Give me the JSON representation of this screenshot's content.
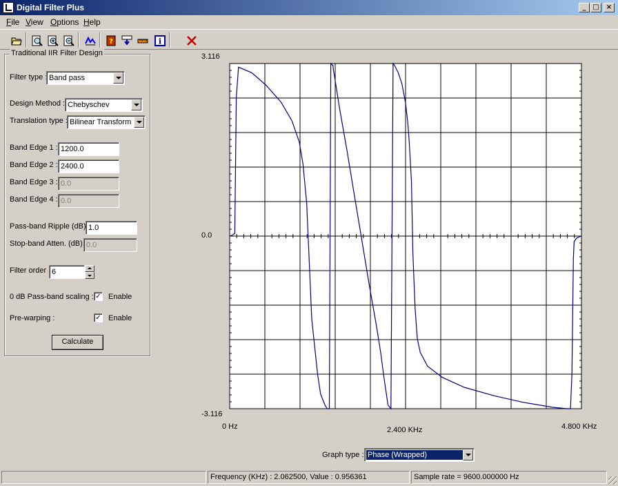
{
  "window": {
    "title": "Digital Filter Plus",
    "controls": {
      "minimize": "_",
      "maximize": "□",
      "close": "×"
    }
  },
  "menu": [
    {
      "label": "File",
      "mnemonic": "F",
      "rest": "ile"
    },
    {
      "label": "View",
      "mnemonic": "V",
      "rest": "iew"
    },
    {
      "label": "Options",
      "mnemonic": "O",
      "rest": "ptions"
    },
    {
      "label": "Help",
      "mnemonic": "H",
      "rest": "elp"
    }
  ],
  "toolbar": {
    "icons": [
      "open-folder-icon",
      "zoom-icon",
      "zoom-in-icon",
      "zoom-out-icon",
      "filter-response-icon",
      "help-icon",
      "download-icon",
      "ruler-icon",
      "info-icon",
      "close-design-icon"
    ]
  },
  "design": {
    "group_title": "Traditional IIR Filter Design",
    "filter_type": {
      "label": "Filter type :",
      "value": "Band pass"
    },
    "design_method": {
      "label": "Design Method :",
      "value": "Chebyschev"
    },
    "translation_type": {
      "label": "Translation type :",
      "value": "Bilinear Transform"
    },
    "band_edge_1": {
      "label": "Band Edge 1 :",
      "value": "1200.0"
    },
    "band_edge_2": {
      "label": "Band Edge 2 :",
      "value": "2400.0"
    },
    "band_edge_3": {
      "label": "Band Edge 3 :",
      "value": "0.0"
    },
    "band_edge_4": {
      "label": "Band Edge 4 :",
      "value": "0.0"
    },
    "passband_ripple": {
      "label": "Pass-band Ripple (dB):",
      "value": "1.0"
    },
    "stopband_atten": {
      "label": "Stop-band Atten. (dB):",
      "value": "0.0"
    },
    "filter_order": {
      "label": "Filter order :",
      "value": "6"
    },
    "passband_scaling": {
      "label": "0 dB Pass-band scaling :",
      "check_label": "Enable",
      "checked": true
    },
    "prewarping": {
      "label": "Pre-warping :",
      "check_label": "Enable",
      "checked": true
    },
    "calculate_label": "Calculate"
  },
  "graph": {
    "graph_type_label": "Graph type :",
    "graph_type_value": "Phase (Wrapped)",
    "line_color": "#00007f"
  },
  "chart_data": {
    "type": "line",
    "title": "",
    "xlabel": "",
    "ylabel": "",
    "x_tick_labels": [
      "0 Hz",
      "2.400 KHz",
      "4.800 KHz"
    ],
    "y_tick_labels": [
      "3.116",
      "0.0",
      "-3.116"
    ],
    "xlim": [
      0,
      4.8
    ],
    "ylim": [
      -3.116,
      3.116
    ],
    "grid": true,
    "series": [
      {
        "x": [
          0.0,
          0.04,
          0.07,
          0.09,
          0.12,
          0.3,
          0.5,
          0.7,
          0.85,
          0.95,
          1.0,
          1.05,
          1.08,
          1.12,
          1.2,
          1.24,
          1.3,
          1.33,
          1.36,
          1.38,
          1.41,
          1.415,
          1.42,
          1.5,
          1.6,
          1.7,
          1.8,
          1.9,
          2.0,
          2.06,
          2.1,
          2.16,
          2.2,
          2.23,
          2.25,
          2.3,
          2.35,
          2.4,
          2.43,
          2.45,
          2.48,
          2.5,
          2.53,
          2.56,
          2.6,
          2.7,
          2.9,
          3.2,
          3.6,
          4.0,
          4.4,
          4.6,
          4.65,
          4.67,
          4.69,
          4.7,
          4.73,
          4.76,
          4.8
        ],
        "y": [
          0.0,
          0.02,
          0.05,
          2.5,
          3.05,
          2.95,
          2.72,
          2.42,
          2.08,
          1.7,
          1.3,
          0.6,
          -0.3,
          -1.5,
          -2.5,
          -2.85,
          -3.05,
          -3.116,
          -3.116,
          3.116,
          3.08,
          3.0,
          2.97,
          2.3,
          1.55,
          0.75,
          -0.05,
          -0.85,
          -1.6,
          -2.1,
          -2.5,
          -3.05,
          -3.116,
          3.116,
          3.08,
          2.95,
          2.75,
          2.4,
          2.05,
          1.7,
          1.0,
          -0.3,
          -1.3,
          -1.85,
          -2.1,
          -2.35,
          -2.55,
          -2.73,
          -2.88,
          -3.0,
          -3.09,
          -3.116,
          -3.116,
          -2.5,
          -0.4,
          -0.1,
          -0.04,
          -0.02,
          0.0
        ]
      }
    ]
  },
  "status": {
    "readout": "Frequency (KHz) : 2.062500, Value : 0.956361",
    "sample_rate": "Sample rate = 9600.000000 Hz"
  }
}
